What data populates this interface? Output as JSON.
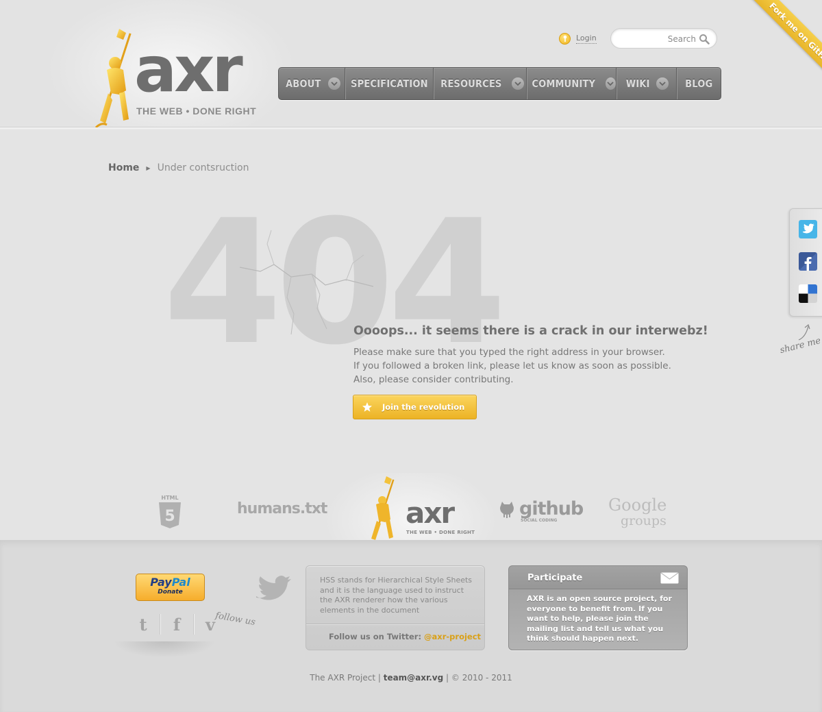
{
  "header": {
    "logo_word": "axr",
    "logo_tagline": "THE WEB  •  DONE RIGHT",
    "login_label": "Login",
    "search_placeholder": "Search",
    "fork_ribbon": "Fork me on GitHub"
  },
  "nav": {
    "items": [
      {
        "label": "ABOUT",
        "has_dropdown": true
      },
      {
        "label": "SPECIFICATION",
        "has_dropdown": false
      },
      {
        "label": "RESOURCES",
        "has_dropdown": true
      },
      {
        "label": "COMMUNITY",
        "has_dropdown": true
      },
      {
        "label": "WIKI",
        "has_dropdown": true
      },
      {
        "label": "BLOG",
        "has_dropdown": false
      }
    ]
  },
  "breadcrumb": {
    "home": "Home",
    "separator": "▶",
    "current": "Under contsruction"
  },
  "error": {
    "code": "404",
    "title": "Oooops... it seems there is a crack in our interwebz!",
    "lines": [
      "Please make sure that you typed the right address in your browser.",
      "If you followed a broken link, please let us know as soon as possible.",
      "Also, please consider contributing."
    ],
    "button_label": "Join the revolution"
  },
  "share": {
    "label": "share me",
    "icons": [
      "twitter-icon",
      "facebook-icon",
      "delicious-icon"
    ]
  },
  "logos": {
    "html5_label": "HTML",
    "html5_number": "5",
    "humans": "humans.txt",
    "axr_word": "axr",
    "axr_tagline": "THE WEB  •  DONE RIGHT",
    "github_word": "github",
    "github_sub": "SOCIAL CODING",
    "google_line1": "Google",
    "google_line2": "groups"
  },
  "footer": {
    "paypal_word1": "Pay",
    "paypal_word2": "Pal",
    "paypal_donate": "Donate",
    "follow_label": "follow us",
    "follow_icons": [
      "t",
      "f",
      "v"
    ],
    "tweet_text": "HSS stands for Hierarchical Style Sheets and it is the language used to instruct the AXR renderer how the various elements in the document",
    "tweet_follow_prefix": "Follow us on Twitter: ",
    "tweet_handle": "@axr-project",
    "participate_title": "Participate",
    "participate_text": "AXR is an open source project, for everyone to benefit from. If you want to help, please join the mailing list and tell us what you think should happen next.",
    "copyright_prefix": "The AXR Project  |  ",
    "copyright_email": "team@axr.vg",
    "copyright_suffix": "  |  © 2010 - 2011"
  },
  "colors": {
    "accent_gold": "#f1b51e",
    "nav_bg": "#7c7c7c",
    "background": "#e4e4e4"
  }
}
